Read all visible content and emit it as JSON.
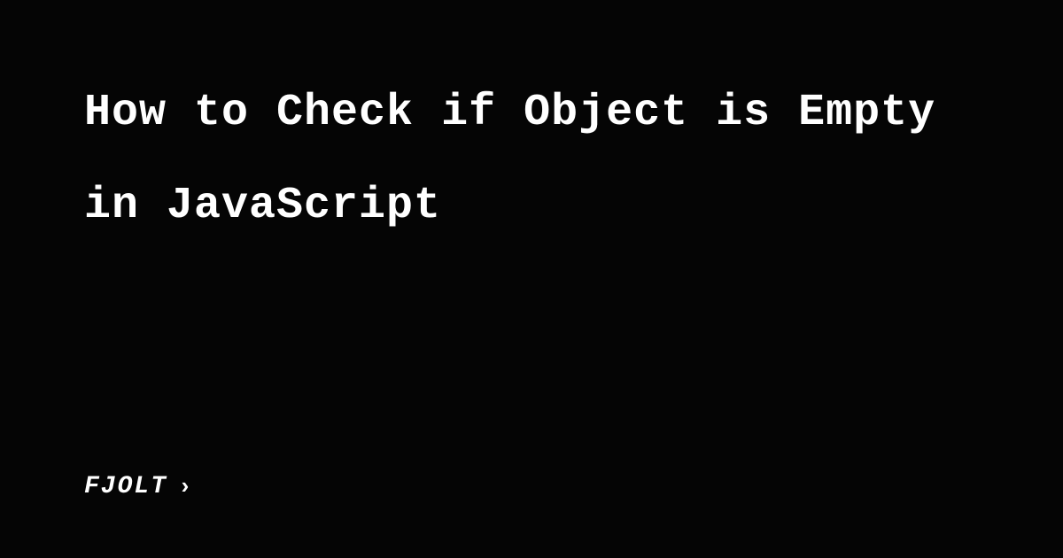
{
  "title": "How to Check if Object is Empty in JavaScript",
  "brand": {
    "name": "FJOLT",
    "chevron": "›"
  }
}
